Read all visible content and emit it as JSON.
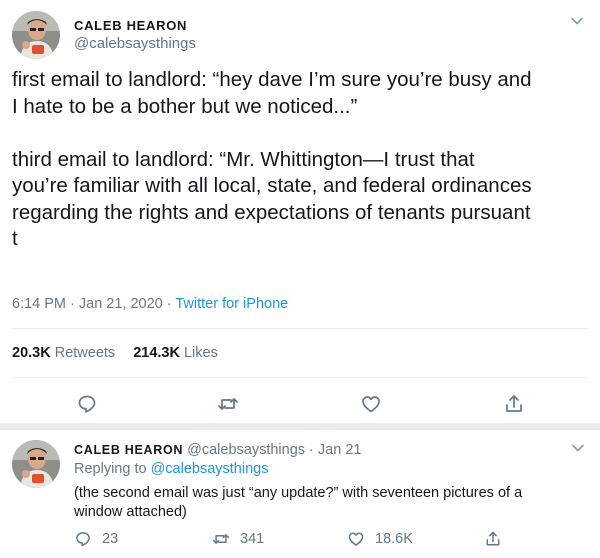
{
  "main_tweet": {
    "author_name": "CALEB HEARON",
    "author_handle": "@calebsaysthings",
    "text": "first email to landlord: “hey dave I’m sure you’re busy and\nI hate to be a bother but we noticed...”\n\nthird email to landlord: “Mr. Whittington—I trust that\nyou’re familiar with all local, state, and federal ordinances\nregarding the rights and expectations of tenants pursuant\nt",
    "time": "6:14 PM",
    "date": "Jan 21, 2020",
    "source": "Twitter for iPhone",
    "retweet_count": "20.3K",
    "retweet_label": "Retweets",
    "like_count": "214.3K",
    "like_label": "Likes",
    "actions": [
      "reply-icon",
      "retweet-icon",
      "like-icon",
      "share-icon"
    ]
  },
  "reply_tweet": {
    "author_name": "CALEB HEARON",
    "author_handle": "@calebsaysthings",
    "date": "Jan 21",
    "replying_label": "Replying to",
    "replying_to": "@calebsaysthings",
    "text": "(the second email was just “any update?” with seventeen pictures of a window attached)",
    "reply_count": "23",
    "retweet_count": "341",
    "like_count": "18.6K"
  },
  "colors": {
    "link": "#1b95e0",
    "secondary_text": "#657786",
    "primary_text": "#14171a",
    "divider": "#e6ecf0"
  }
}
